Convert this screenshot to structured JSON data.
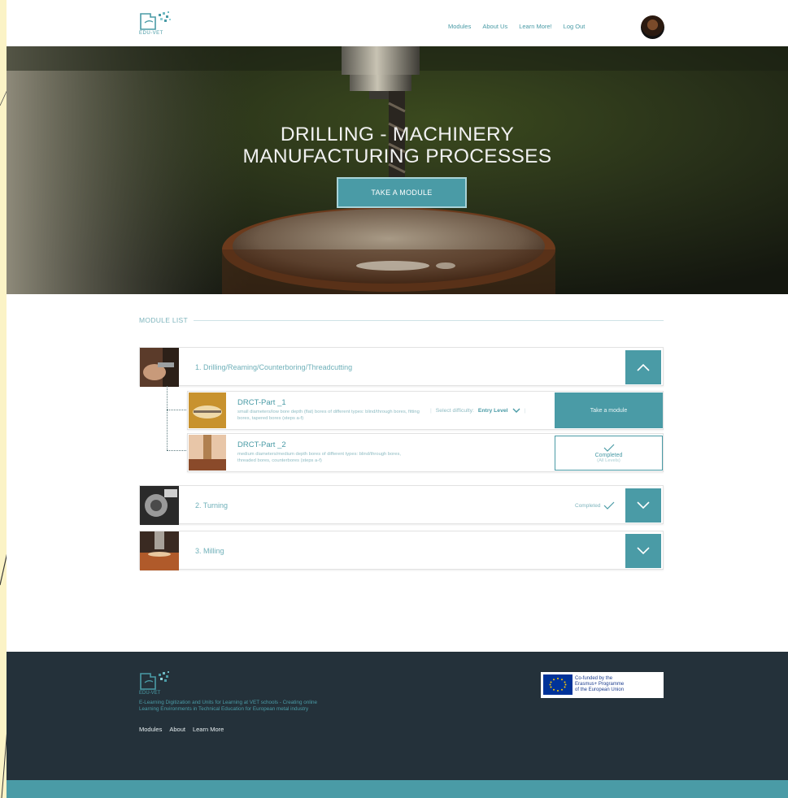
{
  "header": {
    "logo_text": "EDU-VET",
    "nav": [
      "Modules",
      "About Us",
      "Learn More!",
      "Log Out"
    ]
  },
  "hero": {
    "title_line1": "DRILLING - MACHINERY",
    "title_line2": "MANUFACTURING PROCESSES",
    "button": "TAKE A MODULE"
  },
  "module_list": {
    "title": "MODULE LIST",
    "modules": [
      {
        "label": "1. Drilling/Reaming/Counterboring/Threadcutting",
        "expanded": true,
        "parts": [
          {
            "title": "DRCT-Part _1",
            "desc": "small diameters/low bore depth (flat) bores of different types: blind/through bores, fitting bores, tapered bores (steps a-f)",
            "difficulty_label": "Select difficulty:",
            "difficulty_value": "Entry Level",
            "action": "Take a module"
          },
          {
            "title": "DRCT-Part _2",
            "desc": "medium diameters/medium depth bores of different types: blind/through bores, threaded bores, counterbores (steps a-f)",
            "status": "Completed",
            "status_sub": "(All Levels)"
          }
        ]
      },
      {
        "label": "2. Turning",
        "status": "Completed",
        "expanded": false
      },
      {
        "label": "3. Milling",
        "expanded": false
      }
    ]
  },
  "footer": {
    "logo_text": "EDU-VET",
    "description": "E-Learning Digitization and Units for Learning at VET schools - Creating online Learning Environments in Technical Education for European metal industry",
    "links": [
      "Modules",
      "About",
      "Learn More"
    ],
    "eu_text": "Co-funded by the\nErasmus+ Programme\nof the European Union"
  },
  "colors": {
    "accent": "#4a9ba6",
    "footer_bg": "#24313a",
    "slide_bg": "#fbf3c6"
  }
}
